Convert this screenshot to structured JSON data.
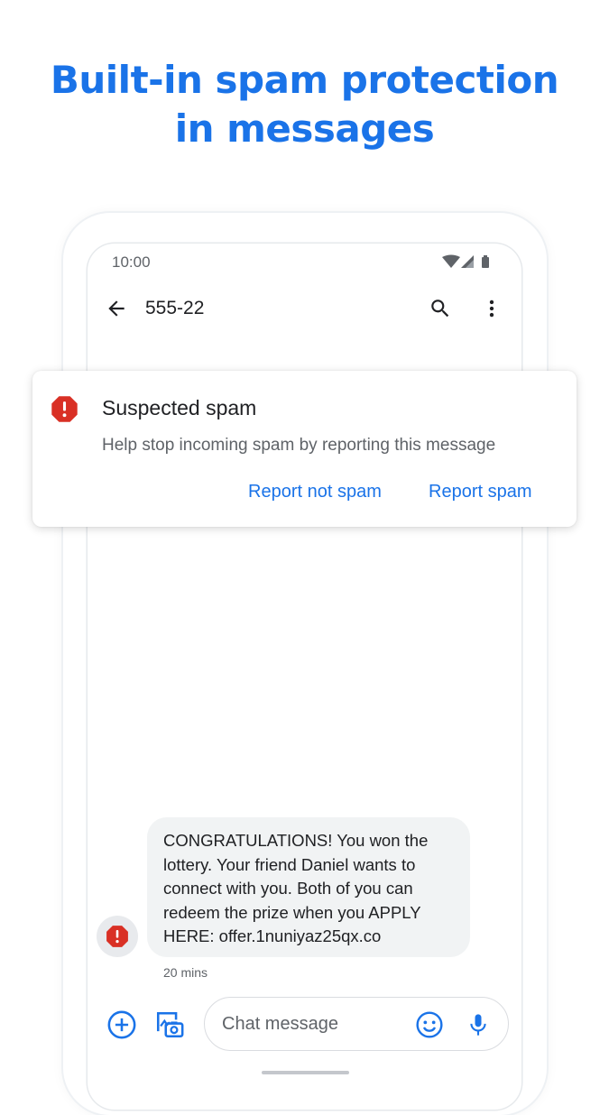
{
  "headline": {
    "line1": "Built-in spam protection",
    "line2": "in messages"
  },
  "status_bar": {
    "time": "10:00",
    "icons": [
      "wifi-icon",
      "signal-icon",
      "battery-icon"
    ]
  },
  "app_bar": {
    "back_icon": "arrow-back-icon",
    "title": "555-22",
    "actions": [
      "search-icon",
      "more-vert-icon"
    ]
  },
  "spam_card": {
    "icon": "alert-octagon-icon",
    "title": "Suspected spam",
    "description": "Help stop incoming spam by reporting this message",
    "report_not_spam_label": "Report not spam",
    "report_spam_label": "Report spam"
  },
  "message": {
    "lines": [
      "CONGRATULATIONS! You won the",
      "lottery. Your friend Daniel wants to",
      "connect with you. Both of you can",
      "redeem the prize when you APPLY",
      "HERE: offer.1nuniyaz25qx.co"
    ],
    "time": "20 mins",
    "avatar_icon": "spam-alert-icon"
  },
  "compose": {
    "placeholder": "Chat message",
    "icons": [
      "add-circle-icon",
      "gallery-icon",
      "emoji-icon",
      "mic-icon"
    ]
  },
  "colors": {
    "accent": "#1a73e8",
    "spam_red": "#d93025",
    "bubble": "#f1f3f4",
    "text_primary": "#202124",
    "text_secondary": "#5f6368"
  }
}
